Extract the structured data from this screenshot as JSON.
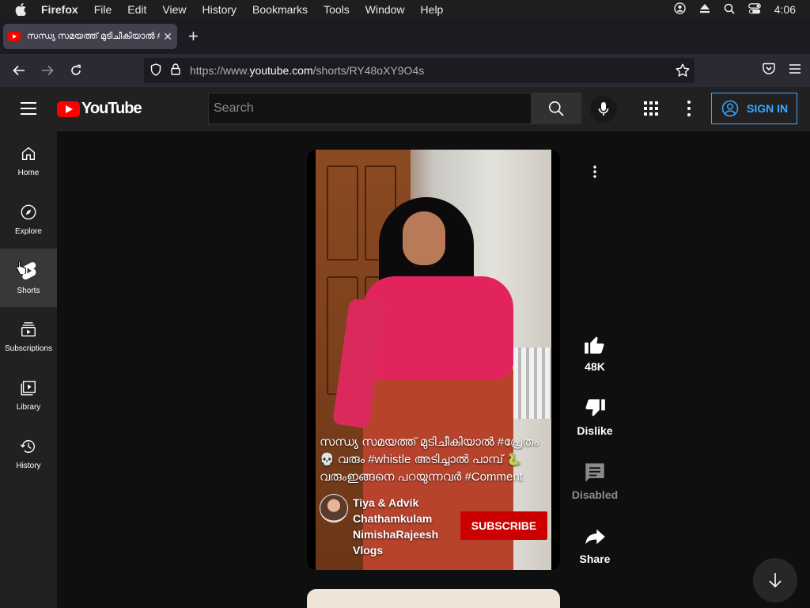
{
  "menubar": {
    "app": "Firefox",
    "items": [
      "File",
      "Edit",
      "View",
      "History",
      "Bookmarks",
      "Tools",
      "Window",
      "Help"
    ],
    "clock": "4:06"
  },
  "browser": {
    "tab_title": "സന്ധ്യ സമയത്ത് മുടിചീകിയാൽ #പ്രേതം",
    "url_prefix": "https://www.",
    "url_domain": "youtube.com",
    "url_path": "/shorts/RY48oXY9O4s"
  },
  "youtube": {
    "logo_text": "YouTube",
    "search_placeholder": "Search",
    "sign_in": "SIGN IN",
    "sidebar": [
      {
        "label": "Home",
        "icon": "home-icon"
      },
      {
        "label": "Explore",
        "icon": "compass-icon"
      },
      {
        "label": "Shorts",
        "icon": "shorts-icon"
      },
      {
        "label": "Subscriptions",
        "icon": "subscriptions-icon"
      },
      {
        "label": "Library",
        "icon": "library-icon"
      },
      {
        "label": "History",
        "icon": "history-icon"
      }
    ]
  },
  "short": {
    "caption": "സന്ധ്യ സമയത്ത് മുടിചീകിയാൽ #പ്രേതം 💀 വരും #whistle അടിച്ചാൽ പാമ്പ് 🐍 വരുംഇങ്ങനെ പറയുന്നവർ #Comment",
    "channel": "Tiya & Advik Chathamkulam NimishaRajeesh Vlogs",
    "subscribe": "SUBSCRIBE",
    "likes": "48K",
    "dislike": "Dislike",
    "comments": "Disabled",
    "share": "Share"
  },
  "colors": {
    "accent_blue": "#3ea6ff",
    "subscribe_red": "#cc0000",
    "brand_red": "#ff0000"
  }
}
